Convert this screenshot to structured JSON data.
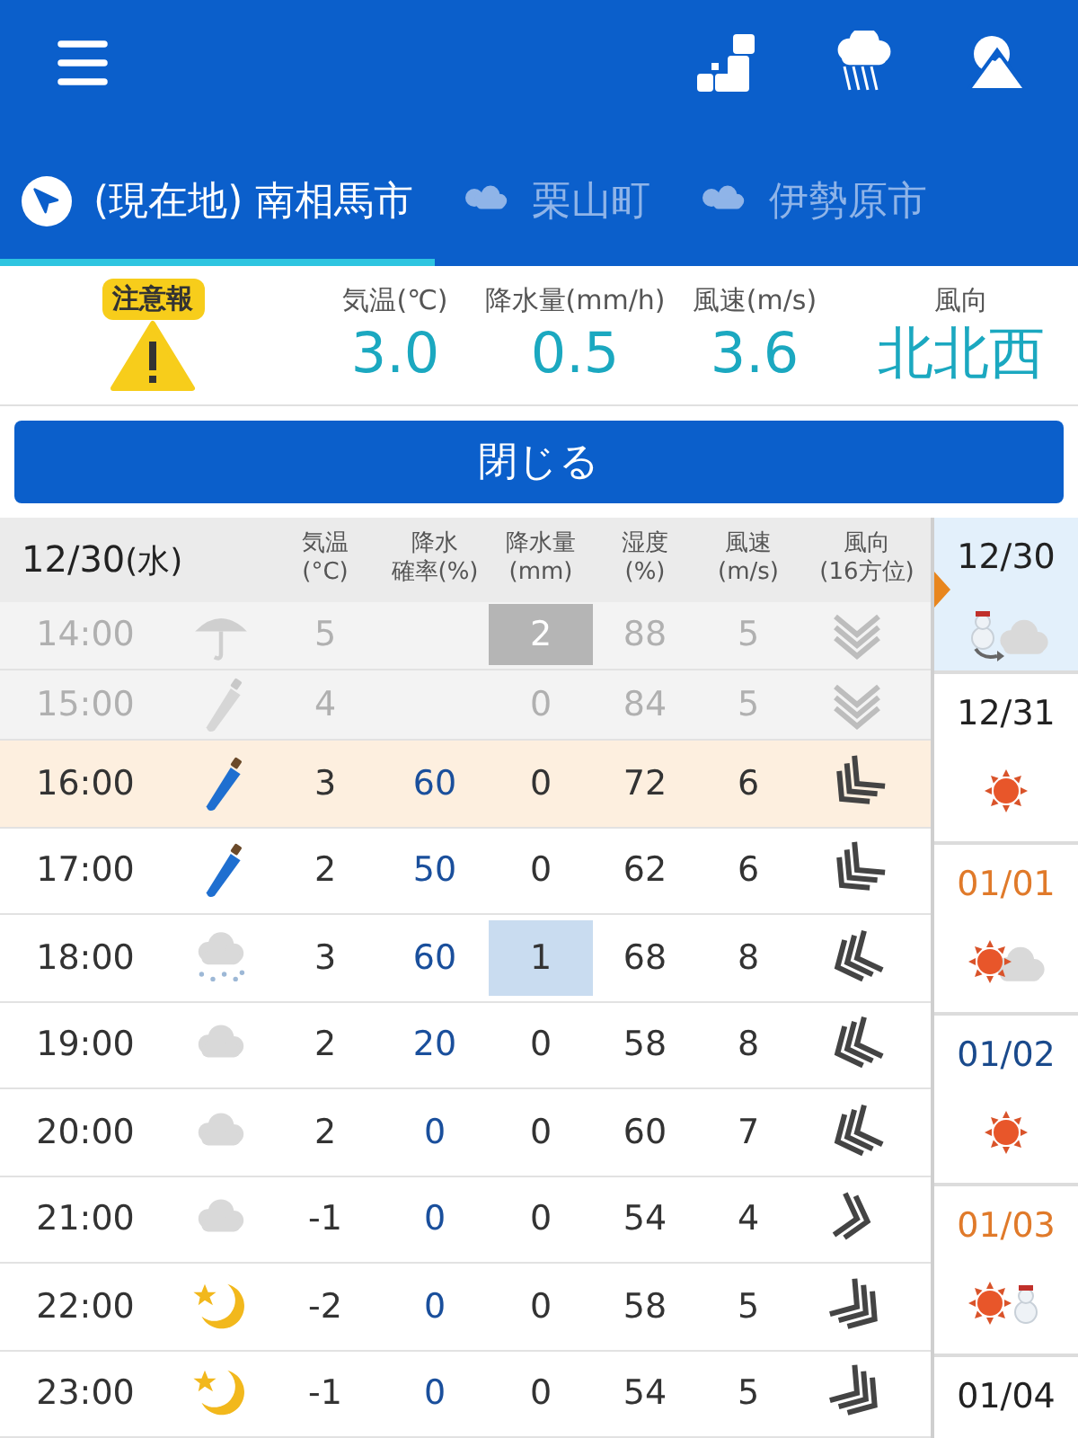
{
  "tabs": [
    {
      "label": "(現在地) 南相馬市",
      "kind": "location",
      "selected": true
    },
    {
      "label": "栗山町",
      "kind": "weather",
      "selected": false
    },
    {
      "label": "伊勢原市",
      "kind": "weather",
      "selected": false
    }
  ],
  "current": {
    "badge": "注意報",
    "warning": true,
    "stats": [
      {
        "label": "気温(℃)",
        "value": "3.0"
      },
      {
        "label": "降水量(mm/h)",
        "value": "0.5"
      },
      {
        "label": "風速(m/s)",
        "value": "3.6"
      },
      {
        "label": "風向",
        "value": "北北西"
      }
    ]
  },
  "close_button": "閉じる",
  "table": {
    "date": "12/30",
    "weekday": "(水)",
    "columns": [
      [
        "気温",
        "(°C)"
      ],
      [
        "降水",
        "確率(%)"
      ],
      [
        "降水量",
        "(mm)"
      ],
      [
        "湿度",
        "(%)"
      ],
      [
        "風速",
        "(m/s)"
      ],
      [
        "風向",
        "(16方位)"
      ]
    ],
    "rows": [
      {
        "time": "14:00",
        "kind": "umbrella-open",
        "past": true,
        "current": false,
        "temp": "5",
        "amount": "2",
        "amount_marked": true,
        "humidity": "88",
        "speed": "5"
      },
      {
        "time": "15:00",
        "kind": "umbrella-closed",
        "past": true,
        "current": false,
        "temp": "4",
        "amount": "0",
        "amount_marked": false,
        "humidity": "84",
        "speed": "5"
      },
      {
        "time": "16:00",
        "kind": "umbrella-closed",
        "past": false,
        "current": true,
        "temp": "3",
        "prob": "60",
        "amount": "0",
        "amount_marked": false,
        "humidity": "72",
        "speed": "6"
      },
      {
        "time": "17:00",
        "kind": "umbrella-closed",
        "past": false,
        "current": false,
        "temp": "2",
        "prob": "50",
        "amount": "0",
        "amount_marked": false,
        "humidity": "62",
        "speed": "6"
      },
      {
        "time": "18:00",
        "kind": "snow-cloud",
        "past": false,
        "current": false,
        "temp": "3",
        "prob": "60",
        "amount": "1",
        "amount_marked": true,
        "humidity": "68",
        "speed": "8"
      },
      {
        "time": "19:00",
        "kind": "cloud",
        "past": false,
        "current": false,
        "temp": "2",
        "prob": "20",
        "amount": "0",
        "amount_marked": false,
        "humidity": "58",
        "speed": "8"
      },
      {
        "time": "20:00",
        "kind": "cloud",
        "past": false,
        "current": false,
        "temp": "2",
        "prob": "0",
        "amount": "0",
        "amount_marked": false,
        "humidity": "60",
        "speed": "7"
      },
      {
        "time": "21:00",
        "kind": "cloud",
        "past": false,
        "current": false,
        "temp": "-1",
        "prob": "0",
        "amount": "0",
        "amount_marked": false,
        "humidity": "54",
        "speed": "4"
      },
      {
        "time": "22:00",
        "kind": "moon",
        "past": false,
        "current": false,
        "temp": "-2",
        "prob": "0",
        "amount": "0",
        "amount_marked": false,
        "humidity": "58",
        "speed": "5"
      },
      {
        "time": "23:00",
        "kind": "moon",
        "past": false,
        "current": false,
        "temp": "-1",
        "prob": "0",
        "amount": "0",
        "amount_marked": false,
        "humidity": "54",
        "speed": "5"
      }
    ]
  },
  "days": [
    {
      "date": "12/30",
      "color": "#222222",
      "selected": true,
      "kind": "snow-to-cloud"
    },
    {
      "date": "12/31",
      "color": "#222222",
      "selected": false,
      "kind": "sun"
    },
    {
      "date": "01/01",
      "color": "#e07a2a",
      "selected": false,
      "kind": "sun-cloud"
    },
    {
      "date": "01/02",
      "color": "#1a4a8c",
      "selected": false,
      "kind": "sun"
    },
    {
      "date": "01/03",
      "color": "#e07a2a",
      "selected": false,
      "kind": "sun-snowman"
    },
    {
      "date": "01/04",
      "color": "#222222",
      "selected": false,
      "kind": "none"
    }
  ]
}
